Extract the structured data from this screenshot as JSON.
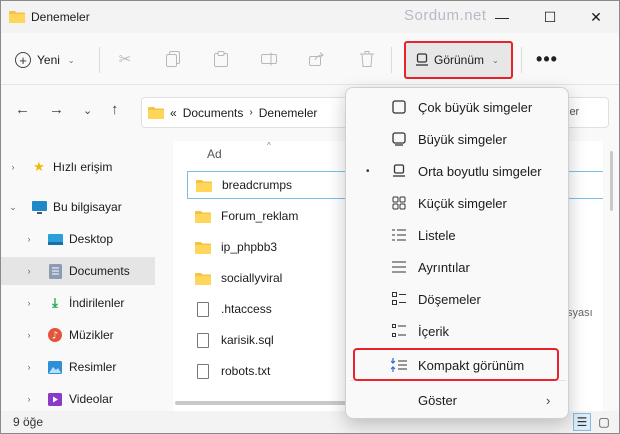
{
  "window": {
    "title": "Denemeler",
    "watermark": "Sordum.net",
    "controls": {
      "minimize": "—",
      "maximize": "☐",
      "close": "✕"
    }
  },
  "toolbar": {
    "new_label": "Yeni",
    "view_label": "Görünüm",
    "more_label": "•••"
  },
  "address": {
    "overflow": "«",
    "segments": [
      "Documents",
      "Denemeler"
    ],
    "search_fragment": "ler"
  },
  "nav_pane": {
    "items": [
      {
        "label": "Hızlı erişim",
        "icon": "star-icon",
        "glyph": "★",
        "color": "#f2b705",
        "selected": false
      },
      {
        "label": "Bu bilgisayar",
        "icon": "computer-icon",
        "glyph": "▬",
        "color": "#1e88c8",
        "selected": false
      },
      {
        "label": "Desktop",
        "icon": "desktop-icon",
        "glyph": "▬",
        "color": "#2a9fd8",
        "selected": false
      },
      {
        "label": "Documents",
        "icon": "documents-icon",
        "glyph": "▤",
        "color": "#6b7c93",
        "selected": true
      },
      {
        "label": "İndirilenler",
        "icon": "download-icon",
        "glyph": "⤓",
        "color": "#1fa34a",
        "selected": false
      },
      {
        "label": "Müzikler",
        "icon": "music-icon",
        "glyph": "♪",
        "color": "#e2553a",
        "selected": false
      },
      {
        "label": "Resimler",
        "icon": "pictures-icon",
        "glyph": "▣",
        "color": "#2d8fd5",
        "selected": false
      },
      {
        "label": "Videolar",
        "icon": "videos-icon",
        "glyph": "▶",
        "color": "#8a3ac8",
        "selected": false
      }
    ]
  },
  "content": {
    "column_header": "Ad",
    "files": [
      {
        "name": "breadcrumps",
        "type": "folder"
      },
      {
        "name": "Forum_reklam",
        "type": "folder"
      },
      {
        "name": "ip_phpbb3",
        "type": "folder"
      },
      {
        "name": "sociallyviral",
        "type": "folder"
      },
      {
        "name": ".htaccess",
        "type": "file"
      },
      {
        "name": "karisik.sql",
        "type": "file"
      },
      {
        "name": "robots.txt",
        "type": "file"
      }
    ],
    "cut_off_text": "syası"
  },
  "status": {
    "count": "9 öğe"
  },
  "view_menu": {
    "items": [
      {
        "label": "Çok büyük simgeler",
        "icon": "extra-large-icons-icon",
        "glyph": "▢",
        "bullet": ""
      },
      {
        "label": "Büyük simgeler",
        "icon": "large-icons-icon",
        "glyph": "▢",
        "bullet": ""
      },
      {
        "label": "Orta boyutlu simgeler",
        "icon": "medium-icons-icon",
        "glyph": "▭",
        "bullet": "•"
      },
      {
        "label": "Küçük simgeler",
        "icon": "small-icons-icon",
        "glyph": "⁘",
        "bullet": ""
      },
      {
        "label": "Listele",
        "icon": "list-icon",
        "glyph": "☰",
        "bullet": ""
      },
      {
        "label": "Ayrıntılar",
        "icon": "details-icon",
        "glyph": "≡",
        "bullet": ""
      },
      {
        "label": "Döşemeler",
        "icon": "tiles-icon",
        "glyph": "☷",
        "bullet": ""
      },
      {
        "label": "İçerik",
        "icon": "content-icon",
        "glyph": "☰",
        "bullet": ""
      },
      {
        "label": "Kompakt görünüm",
        "icon": "compact-view-icon",
        "glyph": "⇕",
        "bullet": ""
      },
      {
        "label": "Göster",
        "icon": "",
        "glyph": "",
        "bullet": "",
        "submenu": "›"
      }
    ]
  },
  "colors": {
    "folder": "#f5c342",
    "highlight": "#e8232a",
    "focus": "#79c0e6"
  }
}
